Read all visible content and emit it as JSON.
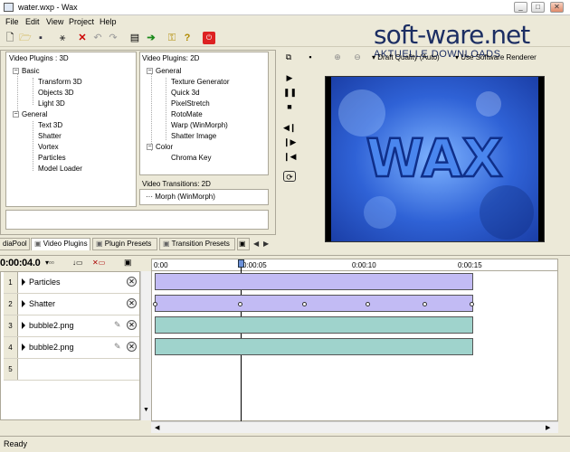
{
  "window": {
    "title": "water.wxp - Wax"
  },
  "menu": [
    "File",
    "Edit",
    "View",
    "Project",
    "Help"
  ],
  "watermark": {
    "brand": "soft-ware.net",
    "tagline": "AKTUELLE DOWNLOADS"
  },
  "panels": {
    "plugins3d": {
      "title": "Video Plugins : 3D",
      "groups": [
        {
          "label": "Basic",
          "items": [
            "Transform 3D",
            "Objects 3D",
            "Light 3D"
          ]
        },
        {
          "label": "General",
          "items": [
            "Text 3D",
            "Shatter",
            "Vortex",
            "Particles",
            "Model Loader"
          ]
        }
      ]
    },
    "plugins2d": {
      "title": "Video Plugins: 2D",
      "groups": [
        {
          "label": "General",
          "items": [
            "Texture Generator",
            "Quick 3d",
            "PixelStretch",
            "RotoMate",
            "Warp (WinMorph)",
            "Shatter Image"
          ]
        },
        {
          "label": "Color",
          "items": [
            "Chroma Key"
          ]
        }
      ]
    },
    "transitions2d": {
      "title": "Video Transitions: 2D",
      "items": [
        "Morph (WinMorph)"
      ]
    }
  },
  "tabs": [
    "diaPool",
    "Video Plugins",
    "Plugin Presets",
    "Transition Presets"
  ],
  "preview": {
    "quality_label": "Draft Quality (Auto)",
    "renderer_label": "Use Software Renderer",
    "frame_text": "WAX"
  },
  "timeline": {
    "current_time": "0:00:04.0",
    "ruler_labels": [
      "0:00",
      "0:00:05",
      "0:00:10",
      "0:00:15"
    ],
    "tracks": [
      {
        "number": "1",
        "name": "Particles",
        "type": "video"
      },
      {
        "number": "2",
        "name": "Shatter",
        "type": "video"
      },
      {
        "number": "3",
        "name": "bubble2.png",
        "type": "image"
      },
      {
        "number": "4",
        "name": "bubble2.png",
        "type": "image"
      },
      {
        "number": "5",
        "name": "",
        "type": "empty"
      }
    ]
  },
  "status": {
    "text": "Ready"
  },
  "colors": {
    "video_clip": "#c2bbf4",
    "image_clip": "#9fd3cc",
    "preview_blue": "#2f62d6"
  }
}
